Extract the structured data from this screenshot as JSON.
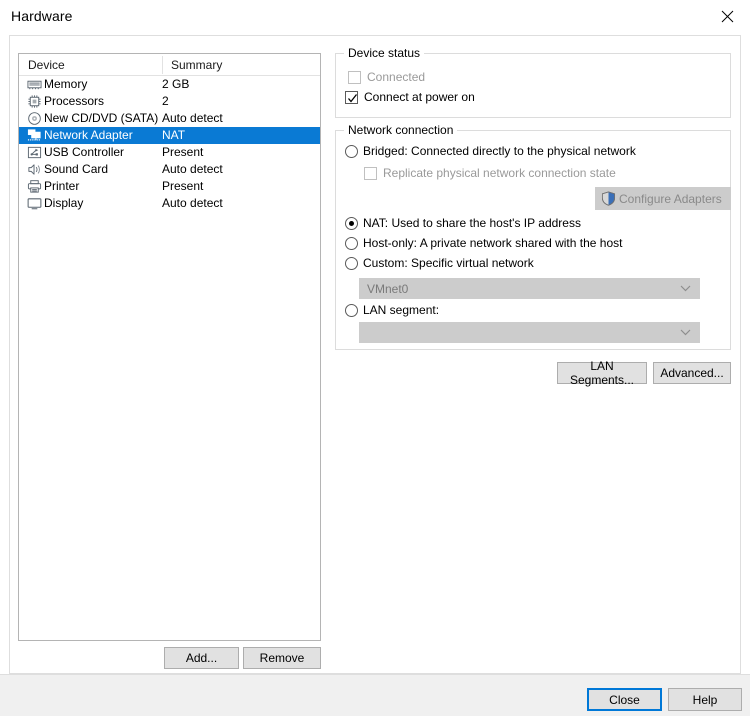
{
  "window": {
    "title": "Hardware",
    "close_icon": "close-icon"
  },
  "device_list": {
    "columns": [
      "Device",
      "Summary"
    ],
    "rows": [
      {
        "icon": "memory-icon",
        "name": "Memory",
        "summary": "2 GB",
        "selected": false
      },
      {
        "icon": "processor-icon",
        "name": "Processors",
        "summary": "2",
        "selected": false
      },
      {
        "icon": "cd-dvd-icon",
        "name": "New CD/DVD (SATA)",
        "summary": "Auto detect",
        "selected": false
      },
      {
        "icon": "network-adapter-icon",
        "name": "Network Adapter",
        "summary": "NAT",
        "selected": true
      },
      {
        "icon": "usb-controller-icon",
        "name": "USB Controller",
        "summary": "Present",
        "selected": false
      },
      {
        "icon": "sound-card-icon",
        "name": "Sound Card",
        "summary": "Auto detect",
        "selected": false
      },
      {
        "icon": "printer-icon",
        "name": "Printer",
        "summary": "Present",
        "selected": false
      },
      {
        "icon": "display-icon",
        "name": "Display",
        "summary": "Auto detect",
        "selected": false
      }
    ],
    "add_label": "Add...",
    "remove_label": "Remove"
  },
  "device_status": {
    "title": "Device status",
    "connected": {
      "label": "Connected",
      "checked": false,
      "enabled": false
    },
    "connect_at_power_on": {
      "label": "Connect at power on",
      "checked": true,
      "enabled": true
    }
  },
  "network_connection": {
    "title": "Network connection",
    "selected": "nat",
    "options": [
      {
        "id": "bridged",
        "label": "Bridged: Connected directly to the physical network"
      },
      {
        "id": "nat",
        "label": "NAT: Used to share the host's IP address"
      },
      {
        "id": "host_only",
        "label": "Host-only: A private network shared with the host"
      },
      {
        "id": "custom",
        "label": "Custom: Specific virtual network"
      },
      {
        "id": "lan",
        "label": "LAN segment:"
      }
    ],
    "replicate_state": {
      "label": "Replicate physical network connection state",
      "checked": false,
      "enabled": false
    },
    "configure_adapters_label": "Configure Adapters",
    "custom_combo": {
      "value": "VMnet0",
      "enabled": false
    },
    "lan_combo": {
      "value": "",
      "enabled": false
    },
    "lan_segments_label": "LAN Segments...",
    "advanced_label": "Advanced..."
  },
  "footer": {
    "close_label": "Close",
    "help_label": "Help"
  },
  "colors": {
    "selection_blue": "#0a7ad4",
    "focus_blue": "#0078d7",
    "button_face": "#e1e1e1",
    "disabled_gray": "#cccccc"
  }
}
